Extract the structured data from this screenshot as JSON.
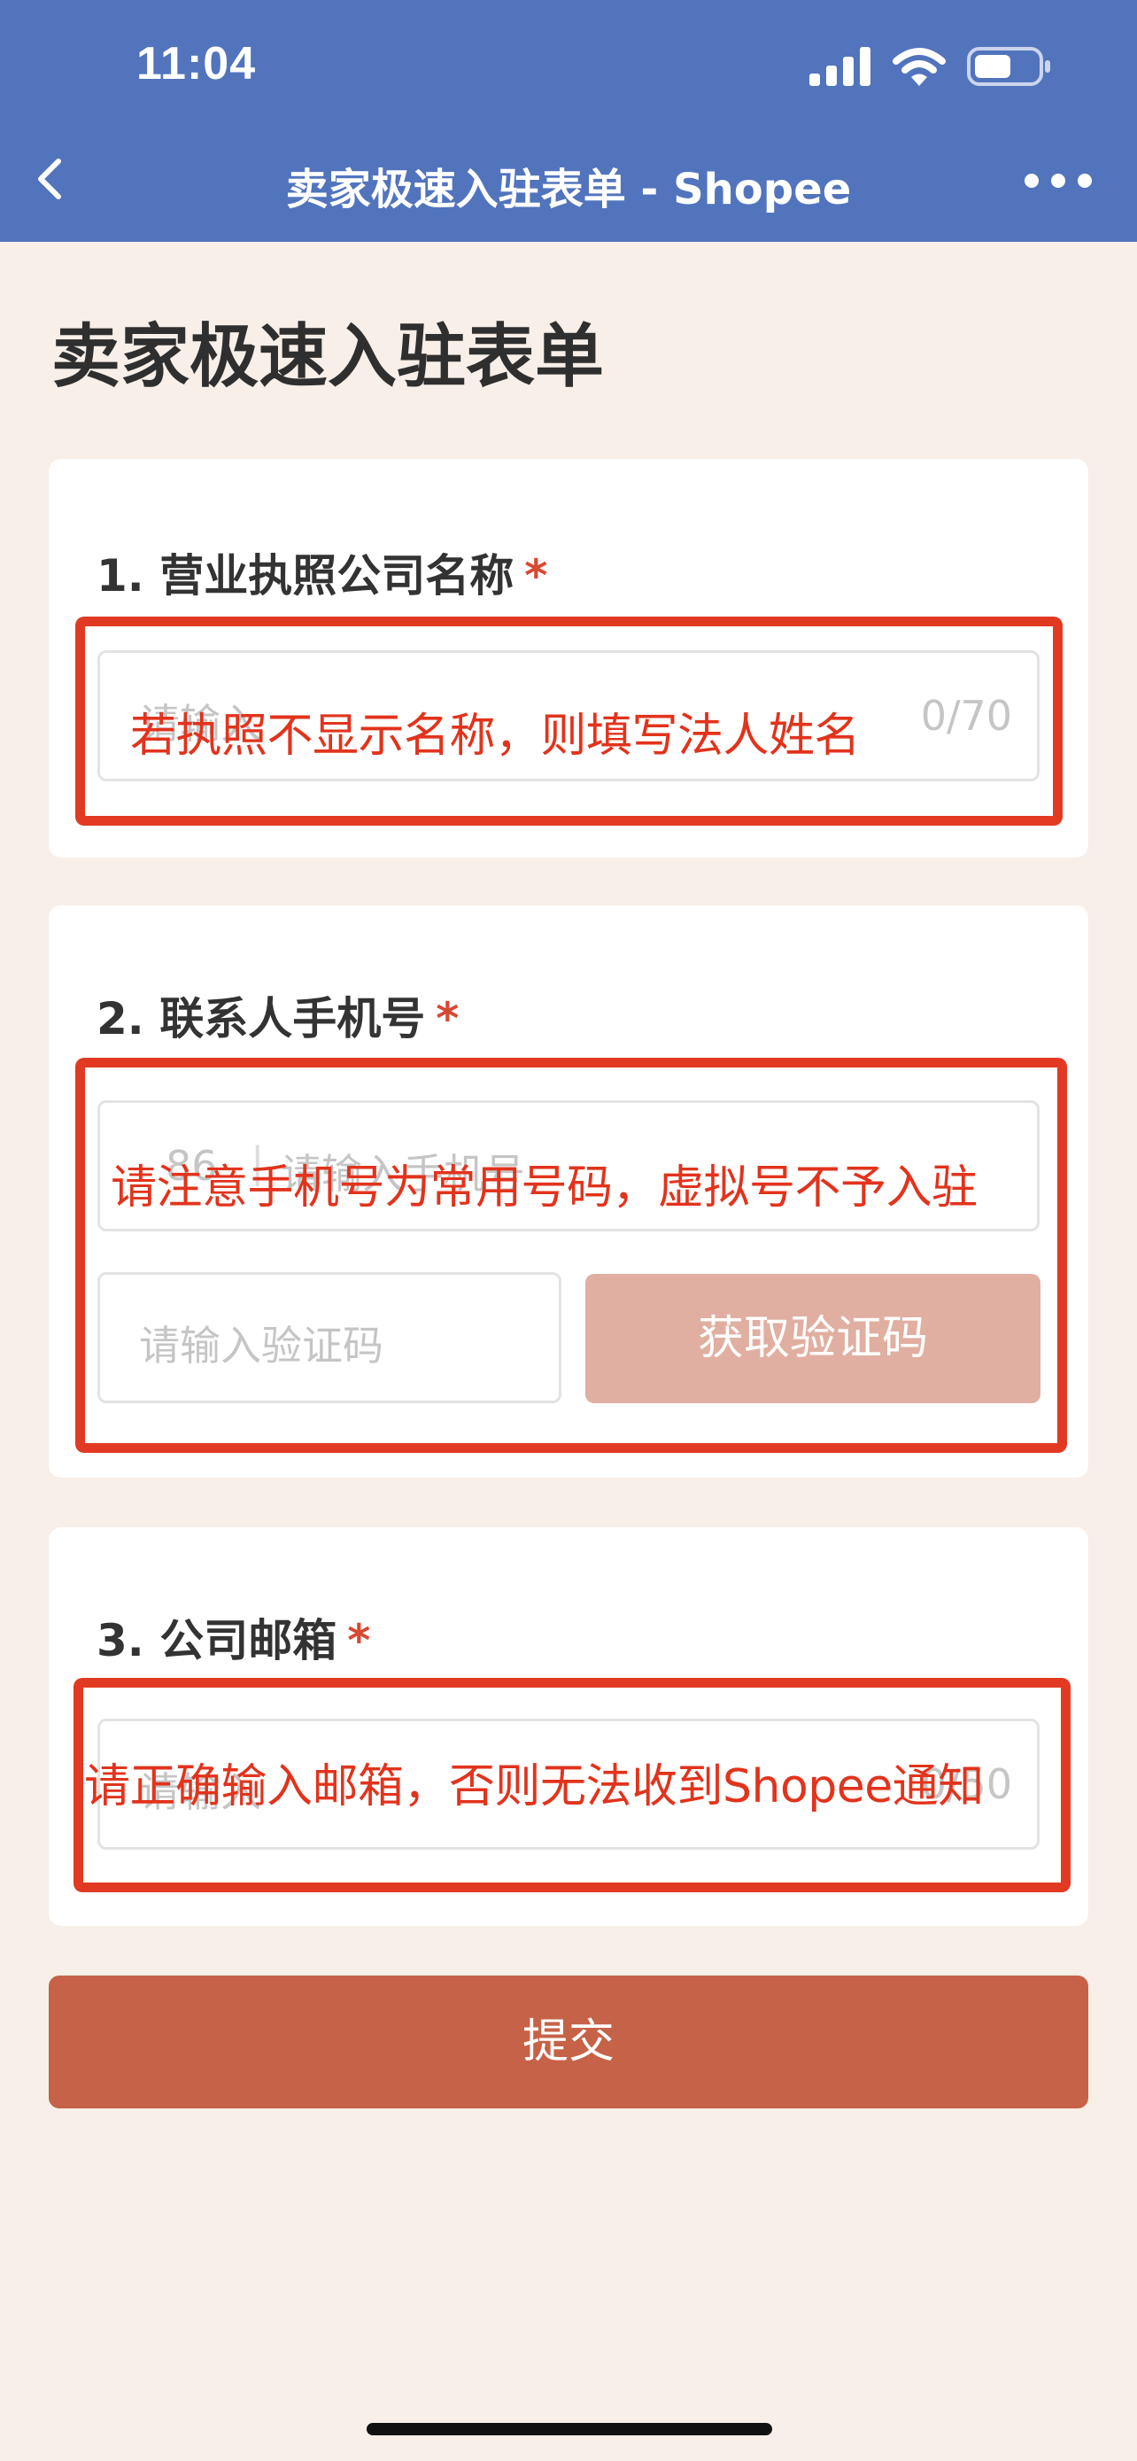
{
  "status_bar": {
    "time": "11:04",
    "icons": [
      "signal-icon",
      "wifi-icon",
      "battery-icon"
    ]
  },
  "nav": {
    "back_icon": "chevron-left-icon",
    "title": "卖家极速入驻表单 - Shopee",
    "more_icon": "more-dots-icon"
  },
  "page": {
    "title": "卖家极速入驻表单"
  },
  "form": {
    "q1": {
      "label": "1. 营业执照公司名称",
      "required_mark": "*",
      "placeholder": "请输入",
      "counter": "0/70",
      "annotation": "若执照不显示名称，则填写法人姓名"
    },
    "q2": {
      "label": "2. 联系人手机号",
      "required_mark": "*",
      "country_code": "86",
      "placeholder": "请输入手机号",
      "code_placeholder": "请输入验证码",
      "code_button": "获取验证码",
      "annotation": "请注意手机号为常用号码，虚拟号不予入驻"
    },
    "q3": {
      "label": "3. 公司邮箱",
      "required_mark": "*",
      "placeholder": "请输入",
      "counter": "0/50",
      "annotation": "请正确输入邮箱，否则无法收到Shopee通知"
    },
    "submit_label": "提交"
  },
  "colors": {
    "header_bg": "#5274bd",
    "page_bg": "#f7efe8",
    "required": "#d64933",
    "annotation": "#e23a22",
    "code_button_bg": "#e0afa1",
    "submit_bg": "#c66247"
  }
}
